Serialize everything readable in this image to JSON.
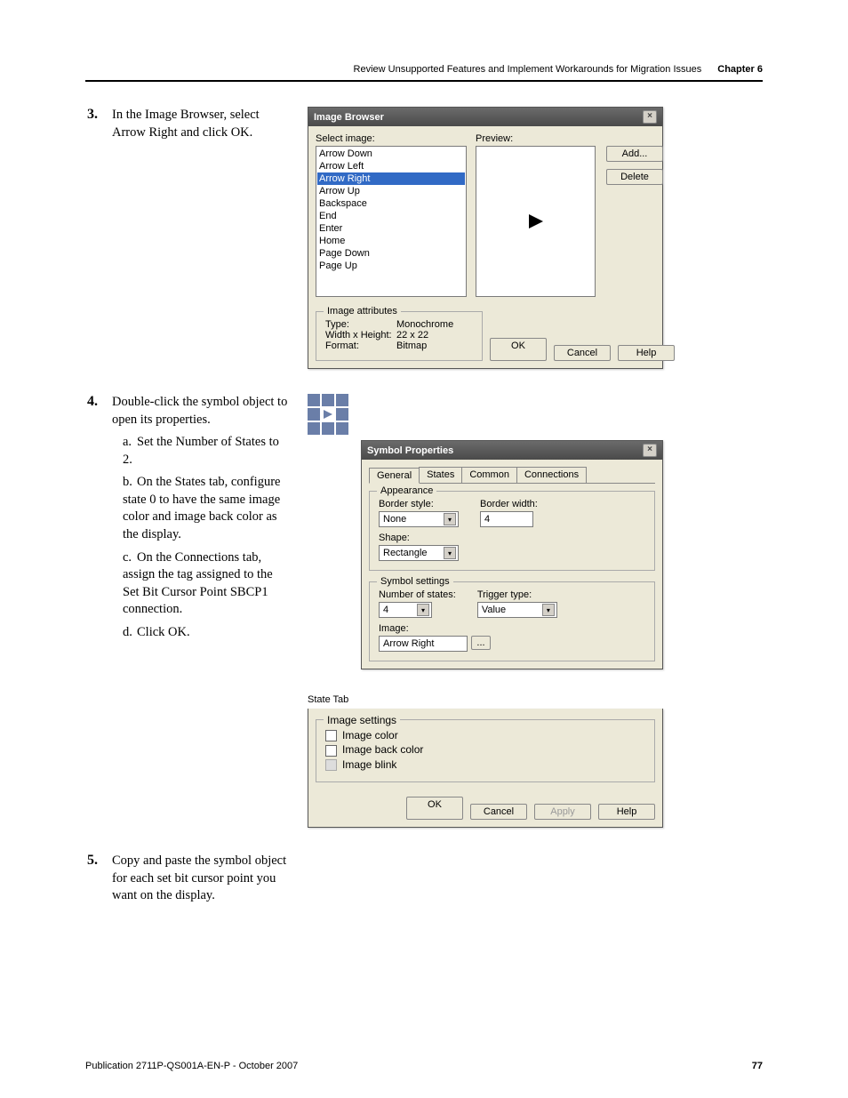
{
  "header": {
    "section": "Review Unsupported Features and Implement Workarounds for Migration Issues",
    "chapter": "Chapter 6"
  },
  "steps": {
    "s3": {
      "num": "3.",
      "text": "In the Image Browser, select Arrow Right and click OK."
    },
    "s4": {
      "num": "4.",
      "text": "Double-click the symbol object to open its properties.",
      "a": "Set the Number of States to 2.",
      "b": "On the States tab, configure state 0 to have the same image color and image back color as the display.",
      "c": "On the Connections tab, assign the tag assigned to the Set Bit Cursor Point SBCP1 connection.",
      "d": "Click OK."
    },
    "s5": {
      "num": "5.",
      "text": "Copy and paste the symbol object for each set bit cursor point you want on the display."
    }
  },
  "image_browser": {
    "title": "Image Browser",
    "select_label": "Select image:",
    "preview_label": "Preview:",
    "items": {
      "i0": "Arrow Down",
      "i1": "Arrow Left",
      "i2": "Arrow Right",
      "i3": "Arrow Up",
      "i4": "Backspace",
      "i5": "End",
      "i6": "Enter",
      "i7": "Home",
      "i8": "Page Down",
      "i9": "Page Up"
    },
    "add_btn": "Add...",
    "delete_btn": "Delete",
    "attr_title": "Image attributes",
    "type_lbl": "Type:",
    "type_val": "Monochrome",
    "wh_lbl": "Width x Height:",
    "wh_val": "22 x 22",
    "format_lbl": "Format:",
    "format_val": "Bitmap",
    "ok": "OK",
    "cancel": "Cancel",
    "help": "Help"
  },
  "symbol_props": {
    "title": "Symbol Properties",
    "tabs": {
      "t0": "General",
      "t1": "States",
      "t2": "Common",
      "t3": "Connections"
    },
    "appearance": {
      "title": "Appearance",
      "border_style_lbl": "Border style:",
      "border_style_val": "None",
      "border_width_lbl": "Border width:",
      "border_width_val": "4",
      "shape_lbl": "Shape:",
      "shape_val": "Rectangle"
    },
    "symbol_settings": {
      "title": "Symbol settings",
      "num_states_lbl": "Number of states:",
      "num_states_val": "4",
      "trigger_lbl": "Trigger type:",
      "trigger_val": "Value",
      "image_lbl": "Image:",
      "image_val": "Arrow Right",
      "browse": "..."
    },
    "ok": "OK",
    "cancel": "Cancel",
    "apply": "Apply",
    "help": "Help"
  },
  "state_tab": {
    "caption": "State Tab",
    "group": "Image settings",
    "image_color": "Image color",
    "image_back_color": "Image back color",
    "image_blink": "Image blink"
  },
  "footer": {
    "pub": "Publication 2711P-QS001A-EN-P - October 2007",
    "page": "77"
  }
}
